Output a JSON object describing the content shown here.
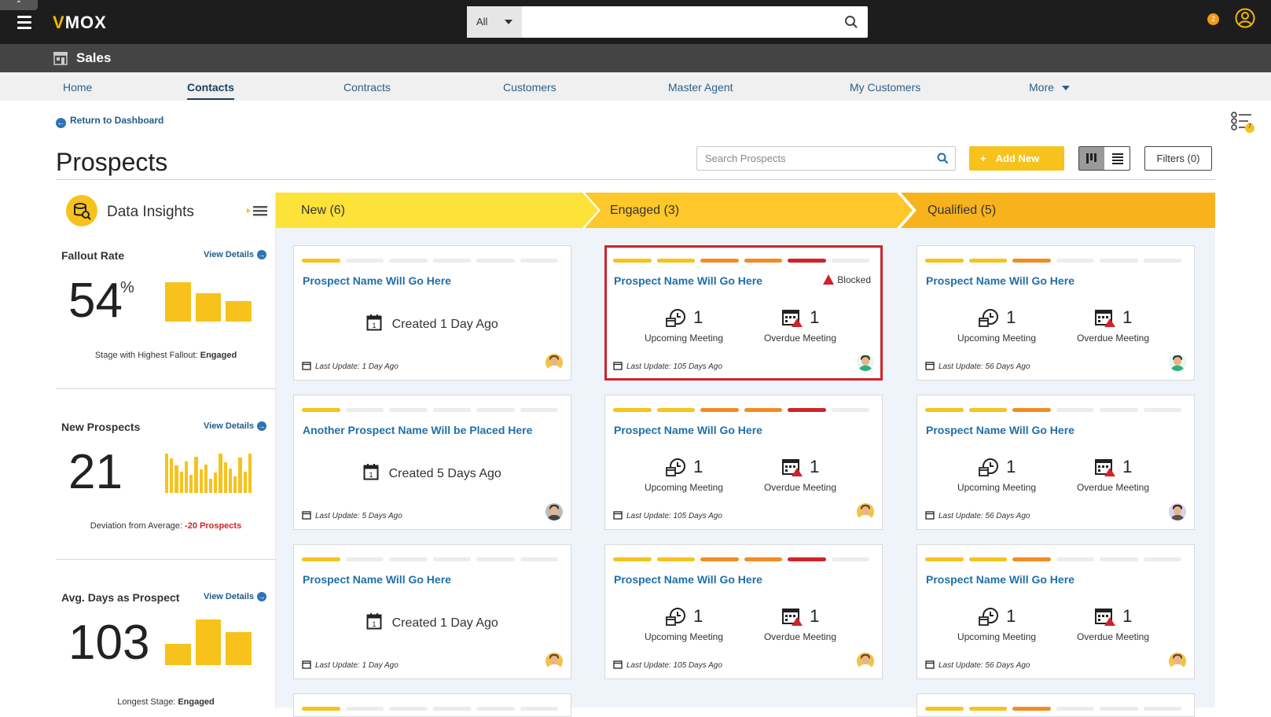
{
  "topbar": {
    "logo": "MOX",
    "logo_mark": "V",
    "search_category": "All",
    "notification_count": "2"
  },
  "subbar": {
    "title": "Sales"
  },
  "nav": {
    "items": [
      "Home",
      "Contacts",
      "Contracts",
      "Customers",
      "Master Agent",
      "My Customers",
      "More"
    ],
    "active": "Contacts"
  },
  "page": {
    "return_link": "Return to Dashboard",
    "title": "Prospects",
    "search_placeholder": "Search Prospects",
    "add_new": "Add New",
    "filters": "Filters (0)",
    "filter_badge": "7"
  },
  "insights": {
    "title": "Data Insights",
    "view_details": "View Details",
    "metrics": [
      {
        "label": "Fallout Rate",
        "value": "54",
        "suffix": "%",
        "note_prefix": "Stage with Highest Fallout:",
        "note_value": "Engaged",
        "bars": [
          100,
          73,
          52
        ]
      },
      {
        "label": "New Prospects",
        "value": "21",
        "note_prefix": "Deviation from Average:",
        "note_value": "-20 Prospects",
        "bars": [
          100,
          88,
          70,
          55,
          80,
          46,
          92,
          60,
          72,
          36,
          52,
          100,
          78,
          62,
          42,
          90,
          54,
          100
        ]
      },
      {
        "label": "Avg. Days as Prospect",
        "value": "103",
        "note_prefix": "Longest Stage:",
        "note_value": "Engaged",
        "bars": [
          46,
          100,
          72
        ]
      }
    ]
  },
  "columns": [
    {
      "label": "New (6)",
      "color": "#fde23a"
    },
    {
      "label": "Engaged (3)",
      "color": "#fec72a"
    },
    {
      "label": "Qualified (5)",
      "color": "#f8b31c"
    }
  ],
  "colors": {
    "progress_yellow": "#f7c21c",
    "progress_orange": "#f28c24",
    "progress_red": "#d0232a",
    "progress_empty": "#ececec",
    "link_blue": "#1f6fa8"
  },
  "cards": {
    "new": [
      {
        "title": "Prospect Name Will Go Here",
        "created": "Created 1 Day Ago",
        "last_update": "Last Update: 1 Day Ago",
        "stages_filled": 1
      },
      {
        "title": "Another Prospect Name Will be Placed Here",
        "created": "Created 5 Days Ago",
        "last_update": "Last Update: 5 Days Ago",
        "stages_filled": 1
      },
      {
        "title": "Prospect Name Will Go Here",
        "created": "Created 1 Day Ago",
        "last_update": "Last Update: 1 Day Ago",
        "stages_filled": 1
      }
    ],
    "engaged": [
      {
        "title": "Prospect Name Will Go Here",
        "blocked": "Blocked",
        "upcoming": "1",
        "upcoming_label": "Upcoming Meeting",
        "overdue": "1",
        "overdue_label": "Overdue Meeting",
        "last_update": "Last Update: 105 Days Ago",
        "stages_filled": 5
      },
      {
        "title": "Prospect Name Will Go Here",
        "upcoming": "1",
        "upcoming_label": "Upcoming Meeting",
        "overdue": "1",
        "overdue_label": "Overdue Meeting",
        "last_update": "Last Update: 105 Days Ago",
        "stages_filled": 5
      },
      {
        "title": "Prospect Name Will Go Here",
        "upcoming": "1",
        "upcoming_label": "Upcoming Meeting",
        "overdue": "1",
        "overdue_label": "Overdue Meeting",
        "last_update": "Last Update: 105 Days Ago",
        "stages_filled": 5
      }
    ],
    "qualified": [
      {
        "title": "Prospect Name Will Go Here",
        "upcoming": "1",
        "upcoming_label": "Upcoming Meeting",
        "overdue": "1",
        "overdue_label": "Overdue Meeting",
        "last_update": "Last Update: 56 Days Ago",
        "stages_filled": 3
      },
      {
        "title": "Prospect Name Will Go Here",
        "upcoming": "1",
        "upcoming_label": "Upcoming Meeting",
        "overdue": "1",
        "overdue_label": "Overdue Meeting",
        "last_update": "Last Update: 56 Days Ago",
        "stages_filled": 3
      },
      {
        "title": "Prospect Name Will Go Here",
        "upcoming": "1",
        "upcoming_label": "Upcoming Meeting",
        "overdue": "1",
        "overdue_label": "Overdue Meeting",
        "last_update": "Last Update: 56 Days Ago",
        "stages_filled": 3
      }
    ]
  }
}
